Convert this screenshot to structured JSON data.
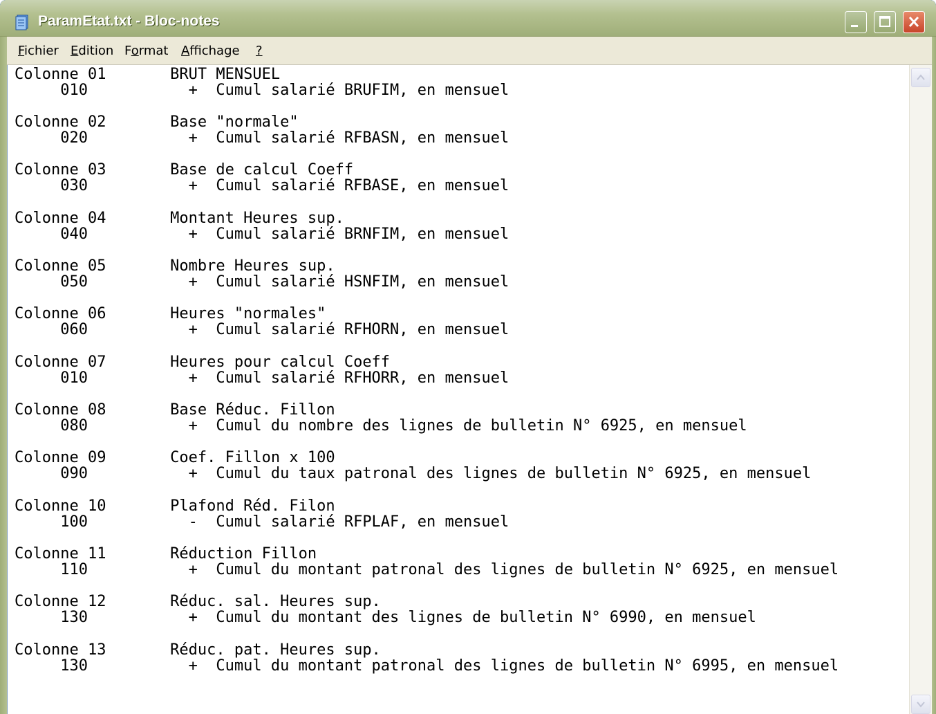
{
  "window": {
    "title": "ParamEtat.txt - Bloc-notes",
    "icon": "notepad-icon"
  },
  "menu": {
    "items": [
      {
        "accel": "F",
        "rest": "ichier"
      },
      {
        "accel": "E",
        "rest": "dition"
      },
      {
        "accel_pre": "F",
        "accel": "o",
        "rest": "rmat"
      },
      {
        "accel": "A",
        "rest": "ffichage"
      },
      {
        "accel": "?",
        "rest": ""
      }
    ]
  },
  "document": {
    "lines": [
      "Colonne 01       BRUT MENSUEL",
      "     010           +  Cumul salarié BRUFIM, en mensuel",
      "Colonne 02       Base \"normale\"",
      "     020           +  Cumul salarié RFBASN, en mensuel",
      "Colonne 03       Base de calcul Coeff",
      "     030           +  Cumul salarié RFBASE, en mensuel",
      "Colonne 04       Montant Heures sup.",
      "     040           +  Cumul salarié BRNFIM, en mensuel",
      "Colonne 05       Nombre Heures sup.",
      "     050           +  Cumul salarié HSNFIM, en mensuel",
      "Colonne 06       Heures \"normales\"",
      "     060           +  Cumul salarié RFHORN, en mensuel",
      "Colonne 07       Heures pour calcul Coeff",
      "     010           +  Cumul salarié RFHORR, en mensuel",
      "Colonne 08       Base Réduc. Fillon",
      "     080           +  Cumul du nombre des lignes de bulletin N° 6925, en mensuel",
      "Colonne 09       Coef. Fillon x 100",
      "     090           +  Cumul du taux patronal des lignes de bulletin N° 6925, en mensuel",
      "Colonne 10       Plafond Réd. Filon",
      "     100           -  Cumul salarié RFPLAF, en mensuel",
      "Colonne 11       Réduction Fillon",
      "     110           +  Cumul du montant patronal des lignes de bulletin N° 6925, en mensuel",
      "Colonne 12       Réduc. sal. Heures sup.",
      "     130           +  Cumul du montant des lignes de bulletin N° 6990, en mensuel",
      "Colonne 13       Réduc. pat. Heures sup.",
      "     130           +  Cumul du montant patronal des lignes de bulletin N° 6995, en mensuel"
    ]
  }
}
